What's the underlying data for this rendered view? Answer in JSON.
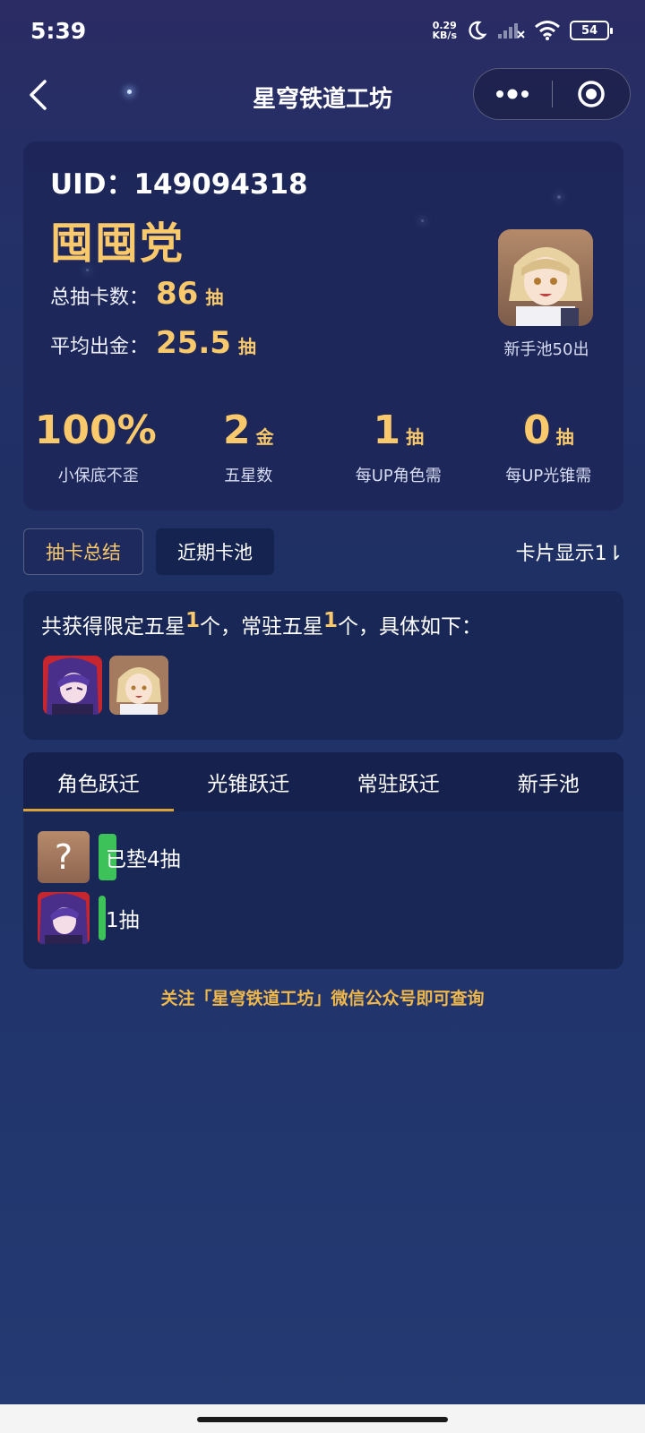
{
  "status_bar": {
    "time": "5:39",
    "net_speed_value": "0.29",
    "net_speed_unit": "KB/s",
    "battery": "54",
    "icons": [
      "moon-icon",
      "signal-icon",
      "wifi-icon",
      "battery-icon"
    ]
  },
  "nav": {
    "title": "星穹铁道工坊",
    "icons": [
      "back-icon",
      "more-icon",
      "target-icon"
    ]
  },
  "profile": {
    "uid_label": "UID：",
    "uid_value": "149094318",
    "nickname": "囤囤党",
    "total_pulls_label": "总抽卡数：",
    "total_pulls_value": "86",
    "total_pulls_unit": "抽",
    "avg_gold_label": "平均出金：",
    "avg_gold_value": "25.5",
    "avg_gold_unit": "抽",
    "avatar_caption": "新手池50出"
  },
  "stats": [
    {
      "value": "100%",
      "unit": "",
      "caption": "小保底不歪"
    },
    {
      "value": "2",
      "unit": "金",
      "caption": "五星数"
    },
    {
      "value": "1",
      "unit": "抽",
      "caption": "每UP角色需"
    },
    {
      "value": "0",
      "unit": "抽",
      "caption": "每UP光锥需"
    }
  ],
  "segments": {
    "summary": "抽卡总结",
    "recent": "近期卡池",
    "card_mode": "卡片显示1⇂"
  },
  "summary": {
    "text_1": "共获得限定五星",
    "limited_count": "1",
    "text_2": "个，常驻五星",
    "standard_count": "1",
    "text_3": "个，具体如下："
  },
  "pool_tabs": [
    "角色跃迁",
    "光锥跃迁",
    "常驻跃迁",
    "新手池"
  ],
  "pool_rows": [
    {
      "label": "已垫4抽",
      "pulls": 4
    },
    {
      "label": "1抽",
      "pulls": 1
    }
  ],
  "footer": "关注「星穹铁道工坊」微信公众号即可查询",
  "colors": {
    "gold": "#f9c96b",
    "progress_green": "#3dc25a",
    "tab_underline": "#d8a43a"
  }
}
